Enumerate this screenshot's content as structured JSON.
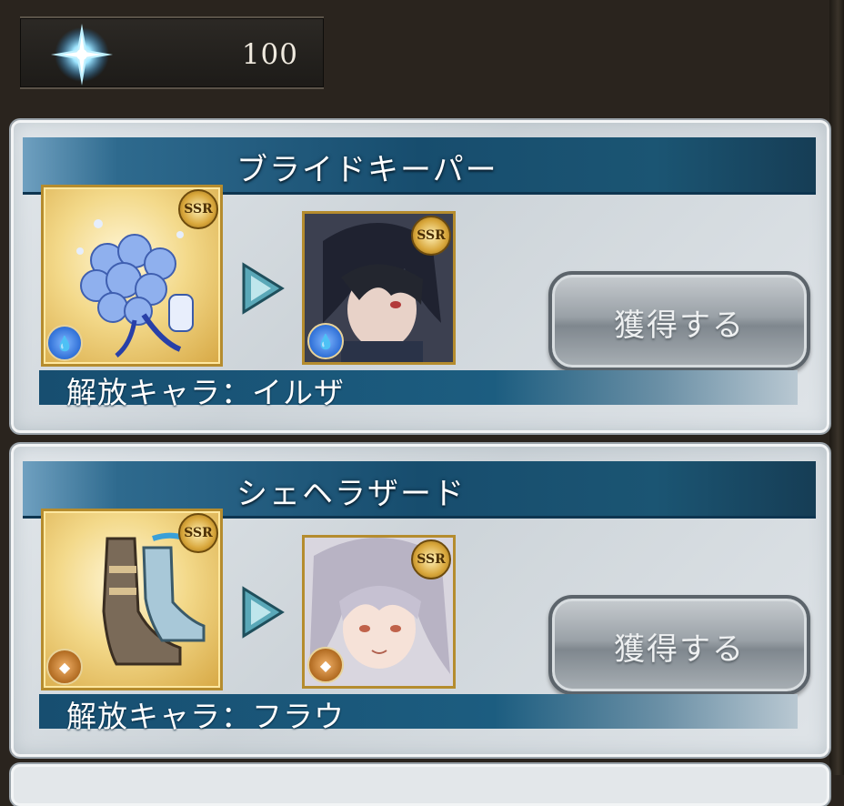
{
  "currency": {
    "icon": "crystal-icon",
    "amount": "100"
  },
  "cards": [
    {
      "title": "ブライドキーパー",
      "item": {
        "rarity": "SSR",
        "element": "water",
        "image": "blue-rose-bouquet"
      },
      "character": {
        "rarity": "SSR",
        "element": "water",
        "image": "dark-haired-character-portrait"
      },
      "button_label": "獲得する",
      "release_label": "解放キャラ：イルザ"
    },
    {
      "title": "シェヘラザード",
      "item": {
        "rarity": "SSR",
        "element": "earth",
        "image": "high-heel-boots"
      },
      "character": {
        "rarity": "SSR",
        "element": "earth",
        "image": "silver-haired-character-portrait"
      },
      "button_label": "獲得する",
      "release_label": "解放キャラ：フラウ"
    }
  ],
  "colors": {
    "background": "#2a241e",
    "title_bar": "#174d6e",
    "button": "#9aa1a7",
    "water_element": "#2f6fd6",
    "earth_element": "#b06a20"
  }
}
